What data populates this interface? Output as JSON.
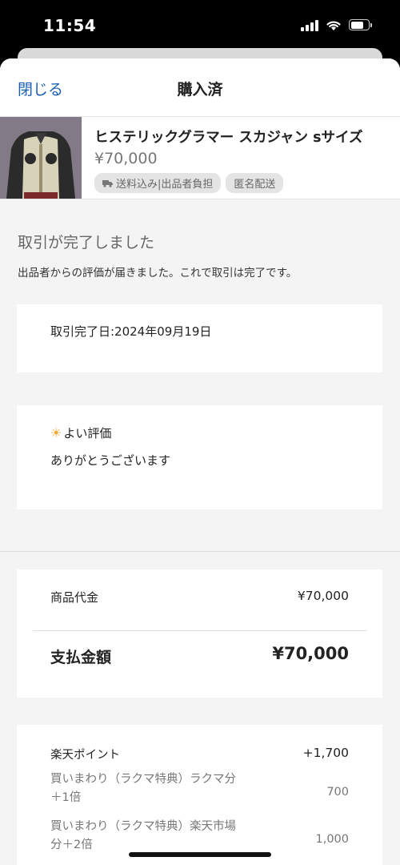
{
  "status_bar": {
    "time": "11:54"
  },
  "nav": {
    "close_label": "閉じる",
    "title": "購入済"
  },
  "product": {
    "name": "ヒステリックグラマー スカジャン sサイズ",
    "price": "¥70,000",
    "tags": [
      "送料込み|出品者負担",
      "匿名配送"
    ]
  },
  "status": {
    "heading": "取引が完了しました",
    "message": "出品者からの評価が届きました。これで取引は完了です。"
  },
  "completion": {
    "date_text": "取引完了日:2024年09月19日"
  },
  "review": {
    "rating_label": "よい評価",
    "comment": "ありがとうございます"
  },
  "payment": {
    "item_label": "商品代金",
    "item_value": "¥70,000",
    "total_label": "支払金額",
    "total_value": "¥70,000"
  },
  "points": {
    "label": "楽天ポイント",
    "value": "+1,700",
    "items": [
      {
        "line1": "買いまわり（ラクマ特典）ラクマ分",
        "line2": "＋1倍",
        "value": "700"
      },
      {
        "line1": "買いまわり（ラクマ特典）楽天市場",
        "line2": "分＋2倍",
        "value": "1,000"
      }
    ]
  },
  "colors": {
    "link": "#1a5fb4",
    "background": "#f4f4f4",
    "review_icon": "#f3a833"
  },
  "icons": {
    "shipping": "truck-icon",
    "review": "sun-icon"
  }
}
